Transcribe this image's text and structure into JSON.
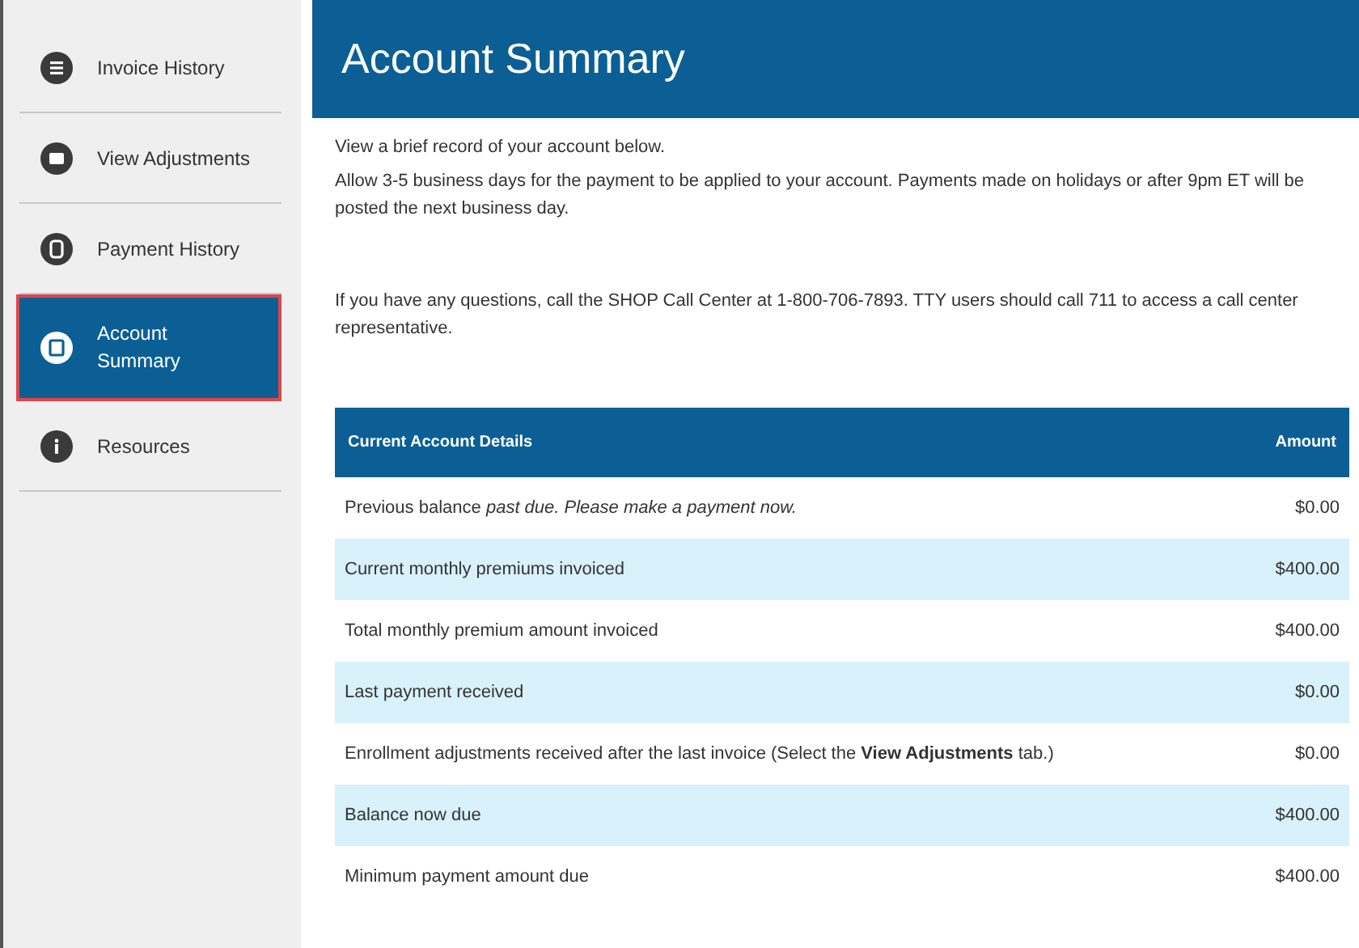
{
  "sidebar": {
    "items": [
      {
        "label": "Invoice History",
        "selected": false
      },
      {
        "label": "View Adjustments",
        "selected": false
      },
      {
        "label": "Payment History",
        "selected": false
      },
      {
        "label": "Account Summary",
        "selected": true
      },
      {
        "label": "Resources",
        "selected": false
      }
    ]
  },
  "header": {
    "title": "Account Summary"
  },
  "intro": [
    "View a brief record of your account below.",
    "Allow 3-5 business days for the payment to be applied to your account. Payments made on holidays or after 9pm ET will be posted the next business day.",
    "If you have any questions, call the SHOP Call Center at 1-800-706-7893. TTY users should call 711 to access a call center representative."
  ],
  "table": {
    "columns": [
      "Current Account Details",
      "Amount"
    ],
    "rows": [
      {
        "detail": "Previous balance *past due. Please make a payment now.*",
        "amount": "$0.00"
      },
      {
        "detail": "Current monthly premiums invoiced",
        "amount": "$400.00"
      },
      {
        "detail": "Total monthly premium amount invoiced",
        "amount": "$400.00"
      },
      {
        "detail": "Last payment received",
        "amount": "$0.00"
      },
      {
        "detail": "Enrollment adjustments received after the last invoice (Select the **View Adjustments** tab.)",
        "amount": "$0.00"
      },
      {
        "detail": "Balance now due",
        "amount": "$400.00"
      },
      {
        "detail": "Minimum payment amount due",
        "amount": "$400.00"
      }
    ]
  }
}
